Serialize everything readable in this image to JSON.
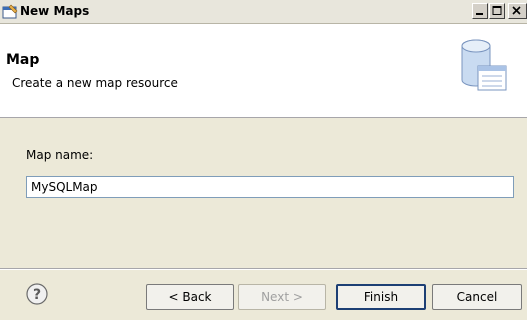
{
  "window": {
    "title": "New Maps",
    "app_icon": "wizard-icon"
  },
  "header": {
    "title": "Map",
    "description": "Create a new map resource",
    "banner_icon": "database-table-icon"
  },
  "form": {
    "name_label": "Map name:",
    "name_value": "MySQLMap"
  },
  "footer": {
    "help_icon": "help-icon",
    "back_label": "< Back",
    "next_label": "Next >",
    "finish_label": "Finish",
    "cancel_label": "Cancel"
  },
  "colors": {
    "accent": "#7f9db9",
    "help_blue": "#3c6eb4"
  }
}
